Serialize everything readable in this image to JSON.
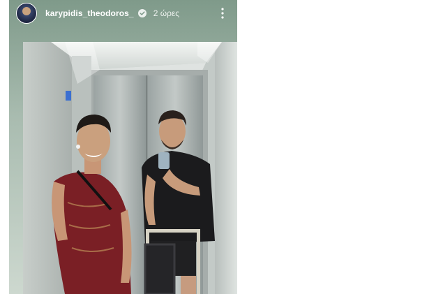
{
  "story": {
    "username": "karypidis_theodoros_",
    "verified": true,
    "timestamp": "2 ώρες",
    "icons": {
      "avatar": "profile-avatar",
      "verified": "verified-badge-icon",
      "more": "more-vertical-icon"
    },
    "photo": {
      "subject": "elevator-mirror-selfie"
    }
  },
  "colors": {
    "header_text": "#ffffff",
    "background_top": "#7f9a8a",
    "background_bottom": "#cdd8cf"
  }
}
